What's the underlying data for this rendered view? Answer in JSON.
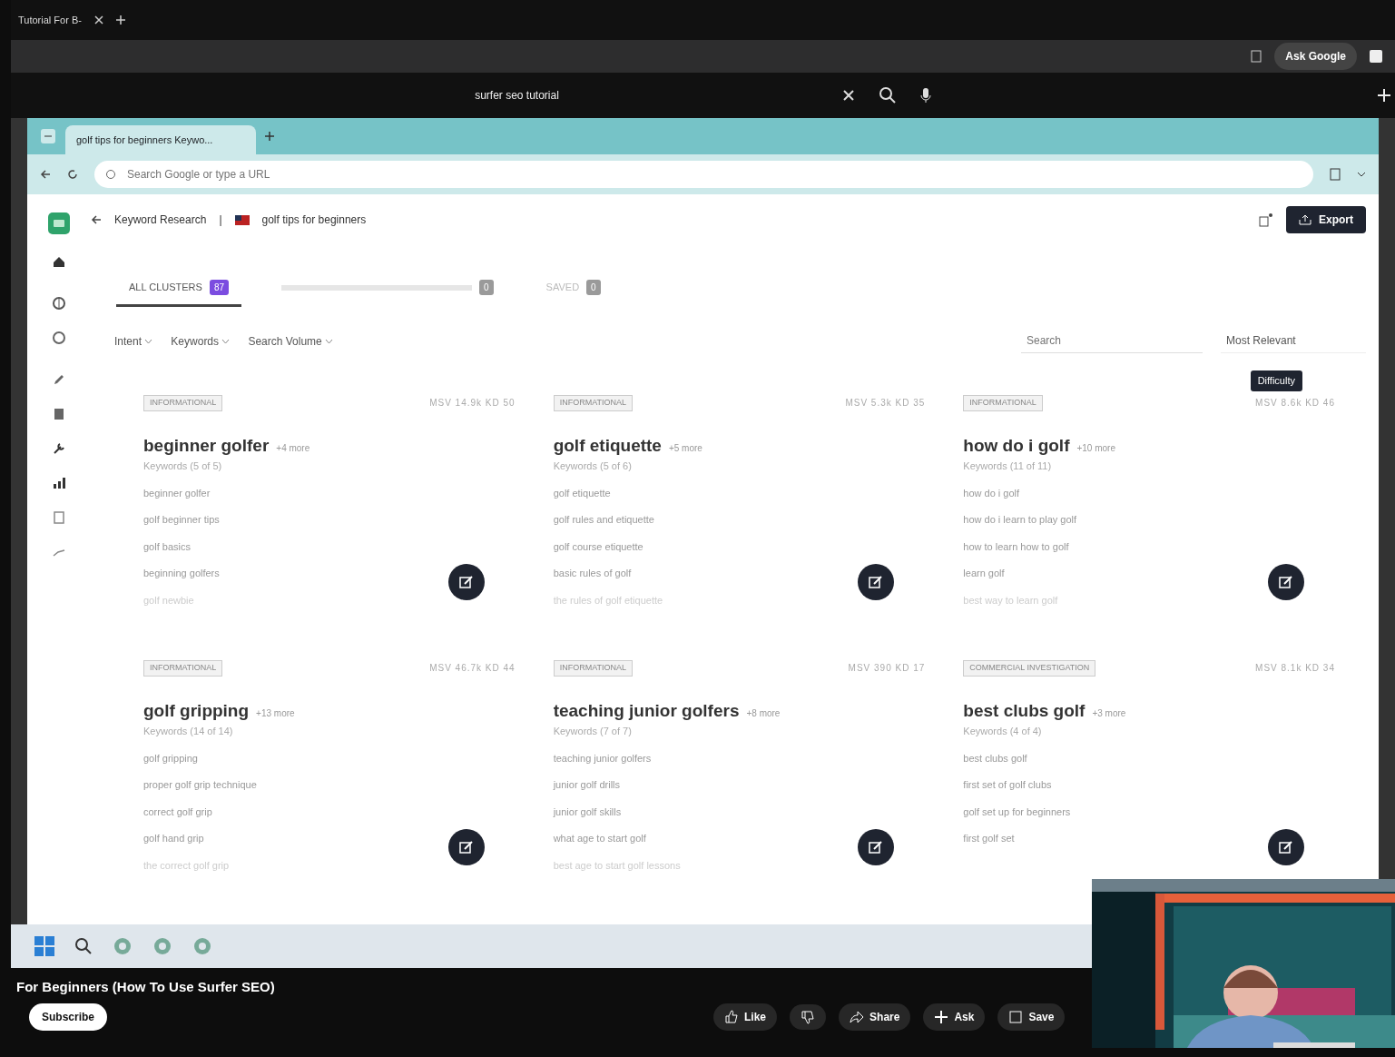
{
  "outer_browser": {
    "tab_title": "Tutorial For B-",
    "ask_button": "Ask Google"
  },
  "search_bar": {
    "query": "surfer seo tutorial"
  },
  "inner_browser": {
    "tab_title": "golf tips for beginners Keywo...",
    "address_placeholder": "Search Google or type a URL"
  },
  "app": {
    "breadcrumb": [
      "Keyword Research",
      "golf tips for beginners"
    ],
    "breadcrumb_separator": "|",
    "export_button": "Export",
    "tabs": [
      {
        "label": "ALL CLUSTERS",
        "count": "87",
        "selected": true
      },
      {
        "count": "0",
        "selected": false
      },
      {
        "label": "SAVED",
        "count": "0",
        "selected": false
      }
    ],
    "filters": [
      "Intent",
      "Keywords",
      "Search Volume"
    ],
    "search": {
      "placeholder": "Search"
    },
    "sort": {
      "value": "Most Relevant"
    },
    "tooltip": "Difficulty",
    "clusters": [
      {
        "intent": "INFORMATIONAL",
        "metrics": "MSV 14.9k KD 50",
        "title": "beginner golfer",
        "more": "+4 more",
        "keyword_count": "Keywords (5 of 5)",
        "keywords": [
          "beginner golfer",
          "golf beginner tips",
          "golf basics",
          "beginning golfers",
          "golf newbie"
        ]
      },
      {
        "intent": "INFORMATIONAL",
        "metrics": "MSV 5.3k KD 35",
        "title": "golf etiquette",
        "more": "+5 more",
        "keyword_count": "Keywords (5 of 6)",
        "keywords": [
          "golf etiquette",
          "golf rules and etiquette",
          "golf course etiquette",
          "basic rules of golf",
          "the rules of golf etiquette"
        ]
      },
      {
        "intent": "INFORMATIONAL",
        "metrics": "MSV 8.6k KD 46",
        "title": "how do i golf",
        "more": "+10 more",
        "keyword_count": "Keywords (11 of 11)",
        "keywords": [
          "how do i golf",
          "how do i learn to play golf",
          "how to learn how to golf",
          "learn golf",
          "best way to learn golf"
        ]
      },
      {
        "intent": "INFORMATIONAL",
        "metrics": "MSV 46.7k KD 44",
        "title": "golf gripping",
        "more": "+13 more",
        "keyword_count": "Keywords (14 of 14)",
        "keywords": [
          "golf gripping",
          "proper golf grip technique",
          "correct golf grip",
          "golf hand grip",
          "the correct golf grip"
        ]
      },
      {
        "intent": "INFORMATIONAL",
        "metrics": "MSV 390 KD 17",
        "title": "teaching junior golfers",
        "more": "+8 more",
        "keyword_count": "Keywords (7 of 7)",
        "keywords": [
          "teaching junior golfers",
          "junior golf drills",
          "junior golf skills",
          "what age to start golf",
          "best age to start golf lessons"
        ]
      },
      {
        "intent": "COMMERCIAL INVESTIGATION",
        "metrics": "MSV 8.1k KD 34",
        "title": "best clubs golf",
        "more": "+3 more",
        "keyword_count": "Keywords (4 of 4)",
        "keywords": [
          "best clubs golf",
          "first set of golf clubs",
          "golf set up for beginners",
          "first golf set"
        ]
      }
    ]
  },
  "video": {
    "title": "For Beginners (How To Use Surfer SEO)",
    "subscribe_button": "Subscribe",
    "actions": [
      {
        "kind": "like",
        "label": "Like"
      },
      {
        "kind": "dislike"
      },
      {
        "kind": "share",
        "label": "Share"
      },
      {
        "kind": "ask",
        "label": "Ask"
      },
      {
        "kind": "save",
        "label": "Save"
      }
    ]
  }
}
